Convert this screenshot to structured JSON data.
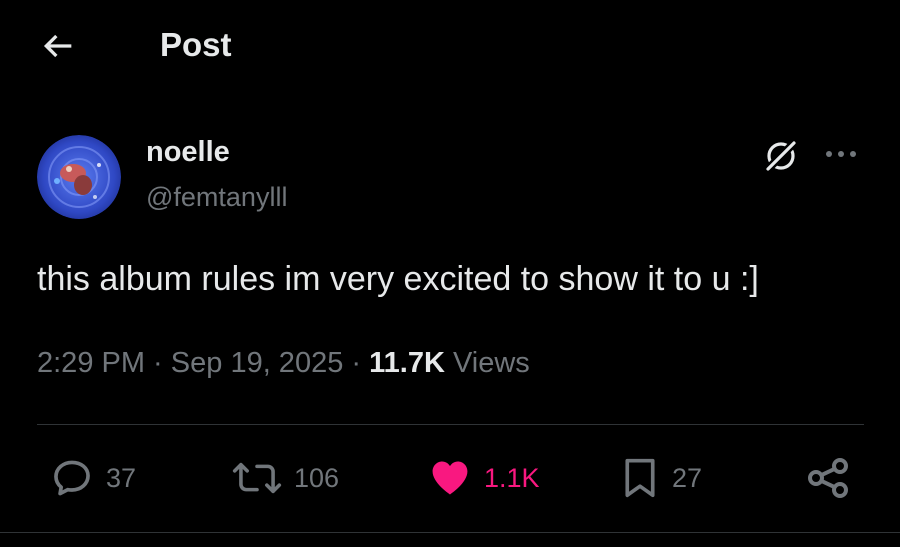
{
  "header": {
    "title": "Post",
    "back_icon": "arrow-left-icon"
  },
  "author": {
    "display_name": "noelle",
    "handle": "@femtanylll",
    "avatar_colors": [
      "#3a5ed8",
      "#2a43b8",
      "#c75a5a"
    ]
  },
  "post": {
    "text": "this album rules im very excited to show it to u :]",
    "time": "2:29 PM",
    "sep1": " · ",
    "date": "Sep 19, 2025",
    "sep2": " · ",
    "views_count": "11.7K",
    "views_label": " Views"
  },
  "actions": {
    "replies": "37",
    "reposts": "106",
    "likes": "1.1K",
    "bookmarks": "27"
  },
  "icons": {
    "grok": "grok-icon",
    "more": "more-dots-icon",
    "reply": "reply-bubble-icon",
    "repost": "repost-icon",
    "like": "heart-icon",
    "bookmark": "bookmark-icon",
    "share": "share-icon"
  },
  "colors": {
    "background": "#000000",
    "text_primary": "#e7e9ea",
    "text_secondary": "#71767b",
    "like_pink": "#f91880",
    "divider": "#2f3336"
  }
}
